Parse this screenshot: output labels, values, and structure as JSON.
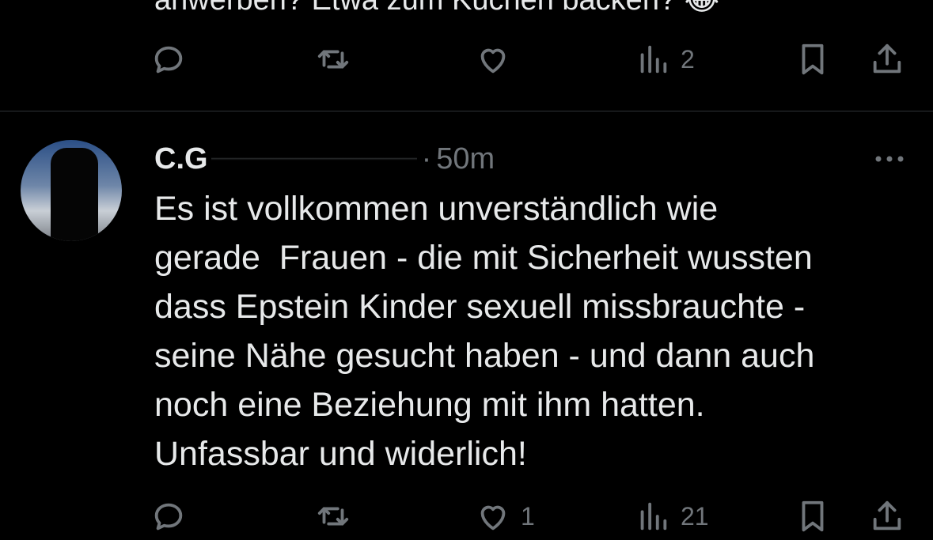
{
  "previous_tweet": {
    "text_fragment": "anwerben? Etwa zum Kuchen backen? 😂",
    "actions": {
      "reply_count": "",
      "retweet_count": "",
      "like_count": "",
      "views_count": "2"
    }
  },
  "tweet": {
    "display_name": "C.G",
    "time": "50m",
    "separator": "·",
    "body_lines": [
      "Es ist vollkommen unverständlich wie",
      "gerade  Frauen - die mit Sicherheit wussten",
      "dass Epstein Kinder sexuell missbrauchte -",
      "seine Nähe gesucht haben - und dann auch",
      "noch eine Beziehung mit ihm hatten.",
      "Unfassbar und widerlich!"
    ],
    "actions": {
      "reply_count": "",
      "retweet_count": "",
      "like_count": "1",
      "views_count": "21"
    }
  },
  "icons": {
    "reply": "reply-icon",
    "retweet": "retweet-icon",
    "like": "heart-icon",
    "views": "views-icon",
    "bookmark": "bookmark-icon",
    "share": "share-icon",
    "more": "more-icon"
  },
  "colors": {
    "background": "#000000",
    "text": "#e7e9ea",
    "muted": "#71767b",
    "divider": "#2f3336"
  }
}
